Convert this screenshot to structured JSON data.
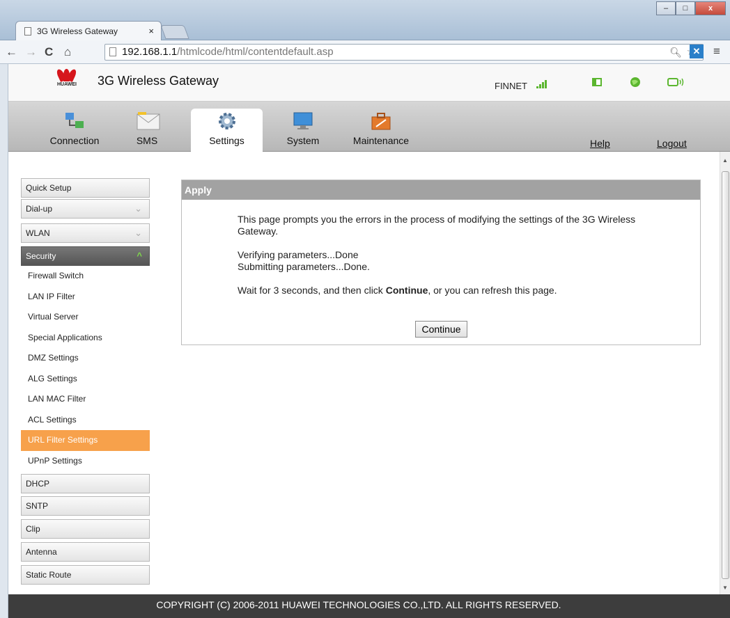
{
  "browser": {
    "tab_title": "3G Wireless Gateway",
    "tab_close": "×",
    "url_host": "192.168.1.1",
    "url_path": "/htmlcode/html/contentdefault.asp",
    "back": "←",
    "forward": "→",
    "reload": "C",
    "home": "⌂",
    "menu": "≡",
    "window_minimize": "–",
    "window_maximize": "□",
    "window_close": "x"
  },
  "header": {
    "logo_text": "HUAWEI",
    "title": "3G Wireless Gateway",
    "carrier": "FINNET",
    "signal_bars": 4
  },
  "nav": {
    "items": [
      {
        "label": "Connection"
      },
      {
        "label": "SMS"
      },
      {
        "label": "Settings"
      },
      {
        "label": "System"
      },
      {
        "label": "Maintenance"
      }
    ],
    "active": "Settings",
    "help": "Help",
    "logout": "Logout"
  },
  "sidebar": {
    "groups_top": [
      {
        "label": "Quick Setup"
      },
      {
        "label": "Dial-up"
      },
      {
        "label": "WLAN"
      },
      {
        "label": "Security"
      }
    ],
    "security_items": [
      {
        "label": "Firewall Switch"
      },
      {
        "label": "LAN IP Filter"
      },
      {
        "label": "Virtual Server"
      },
      {
        "label": "Special Applications"
      },
      {
        "label": "DMZ Settings"
      },
      {
        "label": "ALG Settings"
      },
      {
        "label": "LAN MAC Filter"
      },
      {
        "label": "ACL Settings"
      },
      {
        "label": "URL Filter Settings"
      },
      {
        "label": "UPnP Settings"
      }
    ],
    "active_item": "URL Filter Settings",
    "groups_bottom": [
      {
        "label": "DHCP"
      },
      {
        "label": "SNTP"
      },
      {
        "label": "Clip"
      },
      {
        "label": "Antenna"
      },
      {
        "label": "Static Route"
      }
    ]
  },
  "panel": {
    "heading": "Apply",
    "intro": "This page prompts you the errors in the process of modifying the settings of the 3G Wireless Gateway.",
    "verifying": "Verifying parameters...Done",
    "submitting": "Submitting parameters...Done.",
    "wait_prefix": "Wait for 3 seconds, and then click ",
    "wait_bold": "Continue",
    "wait_suffix": ", or you can refresh this page.",
    "continue_button": "Continue"
  },
  "footer": {
    "copyright": "COPYRIGHT (C) 2006-2011 HUAWEI TECHNOLOGIES CO.,LTD. ALL RIGHTS RESERVED."
  },
  "colors": {
    "active_item": "#f7a14b",
    "panel_header": "#a2a2a2",
    "footer_bg": "#3d3d3d",
    "signal": "#5bb62f",
    "logo_red": "#d6161c"
  }
}
